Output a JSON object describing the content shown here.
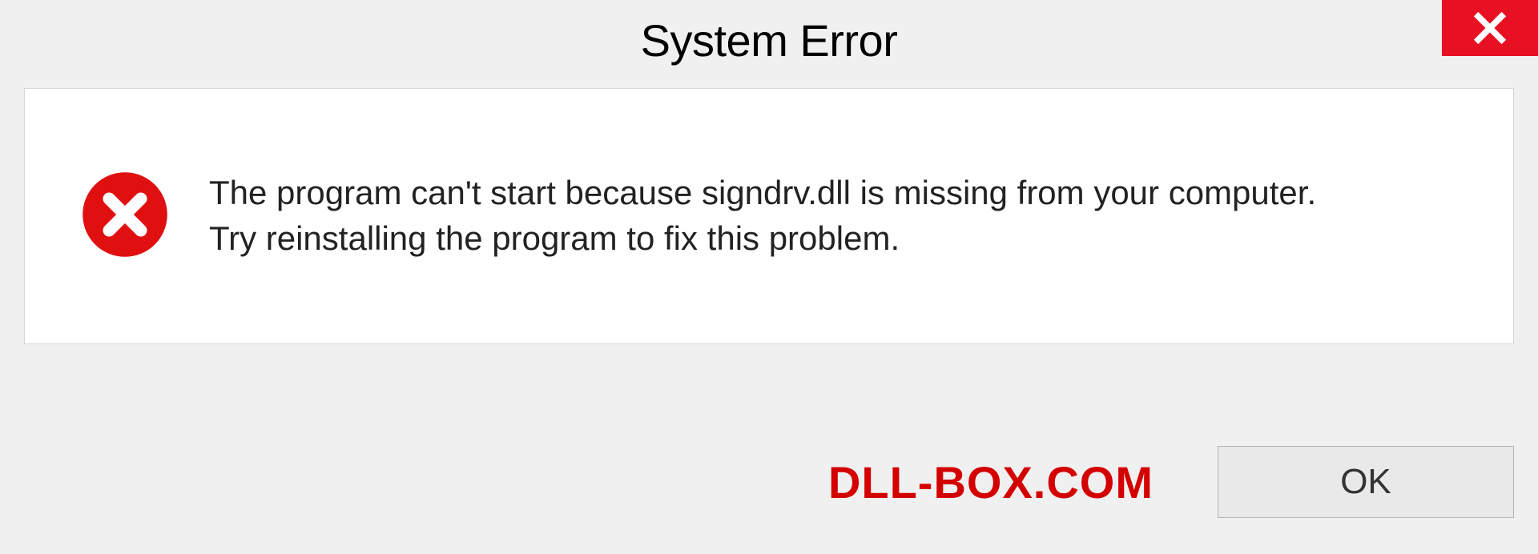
{
  "titlebar": {
    "title": "System Error"
  },
  "message": {
    "line1": "The program can't start because signdrv.dll is missing from your computer.",
    "line2": "Try reinstalling the program to fix this problem."
  },
  "footer": {
    "watermark": "DLL-BOX.COM",
    "ok_label": "OK"
  }
}
